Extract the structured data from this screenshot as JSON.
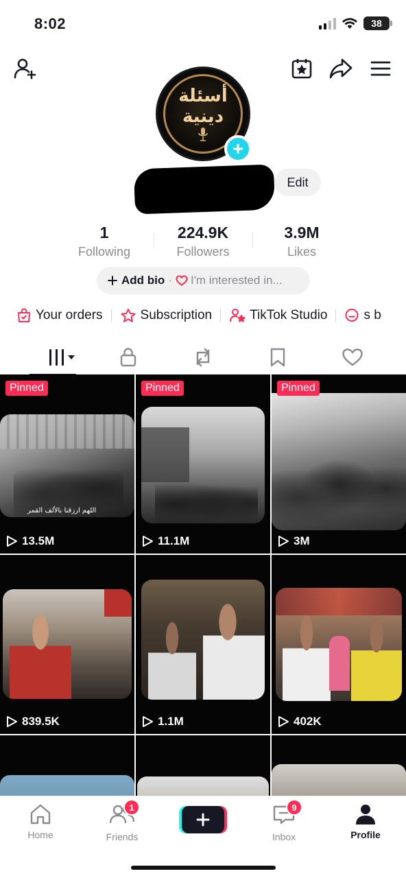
{
  "status_bar": {
    "time": "8:02",
    "battery": "38"
  },
  "profile": {
    "avatar_text_line1": "أسئلة",
    "avatar_text_line2": "دينية",
    "edit_label": "Edit",
    "stats": [
      {
        "value": "1",
        "label": "Following"
      },
      {
        "value": "224.9K",
        "label": "Followers"
      },
      {
        "value": "3.9M",
        "label": "Likes"
      }
    ],
    "bio": {
      "add_label": "Add bio",
      "separator": "·",
      "interest_label": "I'm interested in..."
    }
  },
  "shortcuts": [
    {
      "label": "Your orders"
    },
    {
      "label": "Subscription"
    },
    {
      "label": "TikTok Studio"
    },
    {
      "label": "s b"
    }
  ],
  "videos": [
    {
      "pinned_label": "Pinned",
      "views": "13.5M",
      "caption": "اللهم ارزقنا بالألف القمر"
    },
    {
      "pinned_label": "Pinned",
      "views": "11.1M"
    },
    {
      "pinned_label": "Pinned",
      "views": "3M"
    },
    {
      "views": "839.5K"
    },
    {
      "views": "1.1M"
    },
    {
      "views": "402K"
    },
    {
      "views": ""
    },
    {
      "views": ""
    },
    {
      "views": ""
    }
  ],
  "bottom_nav": {
    "home": "Home",
    "friends": "Friends",
    "friends_badge": "1",
    "inbox": "Inbox",
    "inbox_badge": "9",
    "profile": "Profile"
  },
  "colors": {
    "accent": "#fe2c55",
    "cyan": "#25f4ee",
    "plus": "#20d5ec"
  }
}
